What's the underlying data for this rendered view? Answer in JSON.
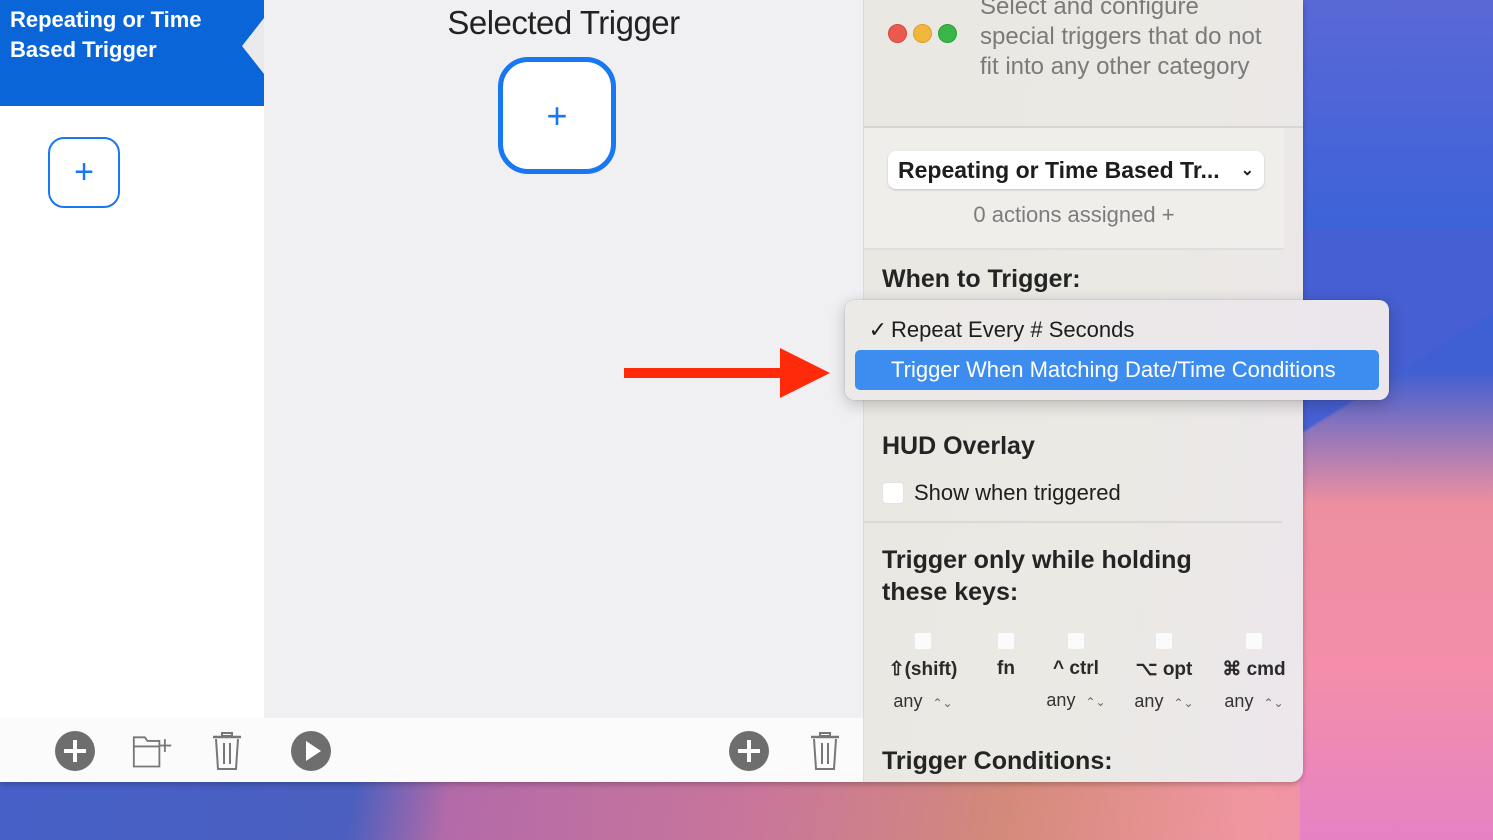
{
  "left_panel": {
    "group_title": "Repeating or Time Based Trigger",
    "add_trigger_label": "+"
  },
  "middle_panel": {
    "title": "Selected Trigger",
    "add_action_label": "+"
  },
  "bottom_toolbar": {
    "left_buttons": [
      "add-trigger",
      "new-folder",
      "delete-trigger",
      "play"
    ],
    "right_buttons": [
      "add-action",
      "delete-action"
    ]
  },
  "inspector": {
    "description": "Select and configure special triggers that do not  fit into any other category",
    "trigger_type_select": "Repeating or Time Based Tr...",
    "actions_assigned": "0 actions assigned +",
    "when_to_trigger_label": "When to Trigger:",
    "hud_overlay_label": "HUD Overlay",
    "hud_show_label": "Show when triggered",
    "hud_show_checked": false,
    "modifier_keys_label": "Trigger only while holding these keys:",
    "modifier_keys": [
      {
        "label": "⇧(shift)",
        "mode": "any",
        "checked": false
      },
      {
        "label": "fn",
        "mode": "",
        "checked": false
      },
      {
        "label": "^ ctrl",
        "mode": "any",
        "checked": false
      },
      {
        "label": "⌥ opt",
        "mode": "any",
        "checked": false
      },
      {
        "label": "⌘ cmd",
        "mode": "any",
        "checked": false
      }
    ],
    "trigger_conditions_label": "Trigger Conditions:"
  },
  "dropdown_menu": {
    "items": [
      {
        "label": "Repeat Every # Seconds",
        "checked": true,
        "check_glyph": "✓"
      },
      {
        "label": "Trigger When Matching Date/Time Conditions",
        "checked": false,
        "highlighted": true
      }
    ]
  },
  "colors": {
    "accent": "#1877f2",
    "group_header": "#0a66d8",
    "menu_highlight": "#3d8df0",
    "annotation_arrow": "#ff2a0a"
  }
}
